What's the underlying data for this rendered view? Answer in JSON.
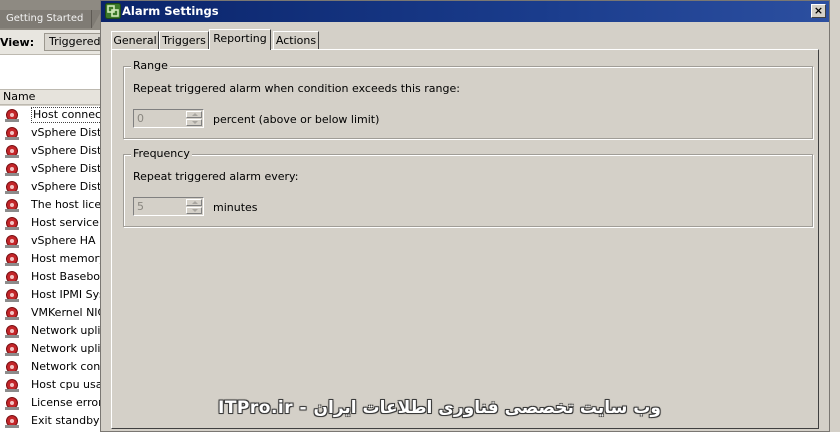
{
  "background_client": {
    "tab_label": "Getting Started",
    "view_label": "View:",
    "view_button": "Triggered",
    "column_header": "Name",
    "alarm_rows": [
      "Host connection",
      "vSphere Distri",
      "vSphere Distri",
      "vSphere Distri",
      "vSphere Distri",
      "The host licens",
      "Host service c",
      "vSphere HA ho",
      "Host memory c",
      "Host Baseboar",
      "Host IPMI Sys",
      "VMKernel NIC",
      "Network uplink",
      "Network uplink",
      "Network conne",
      "Host cpu usag",
      "License error",
      "Exit standby e"
    ]
  },
  "dialog": {
    "title": "Alarm Settings",
    "close_label": "×",
    "tabs": [
      "General",
      "Triggers",
      "Reporting",
      "Actions"
    ],
    "active_tab": "Reporting",
    "range": {
      "group_label": "Range",
      "description": "Repeat triggered alarm when condition exceeds this range:",
      "value": "0",
      "unit": "percent (above or below limit)"
    },
    "frequency": {
      "group_label": "Frequency",
      "description": "Repeat triggered alarm every:",
      "value": "5",
      "unit": "minutes"
    }
  },
  "watermark": "ITPro.ir - وب سایت تخصصی فناوری اطلاعات ایران"
}
